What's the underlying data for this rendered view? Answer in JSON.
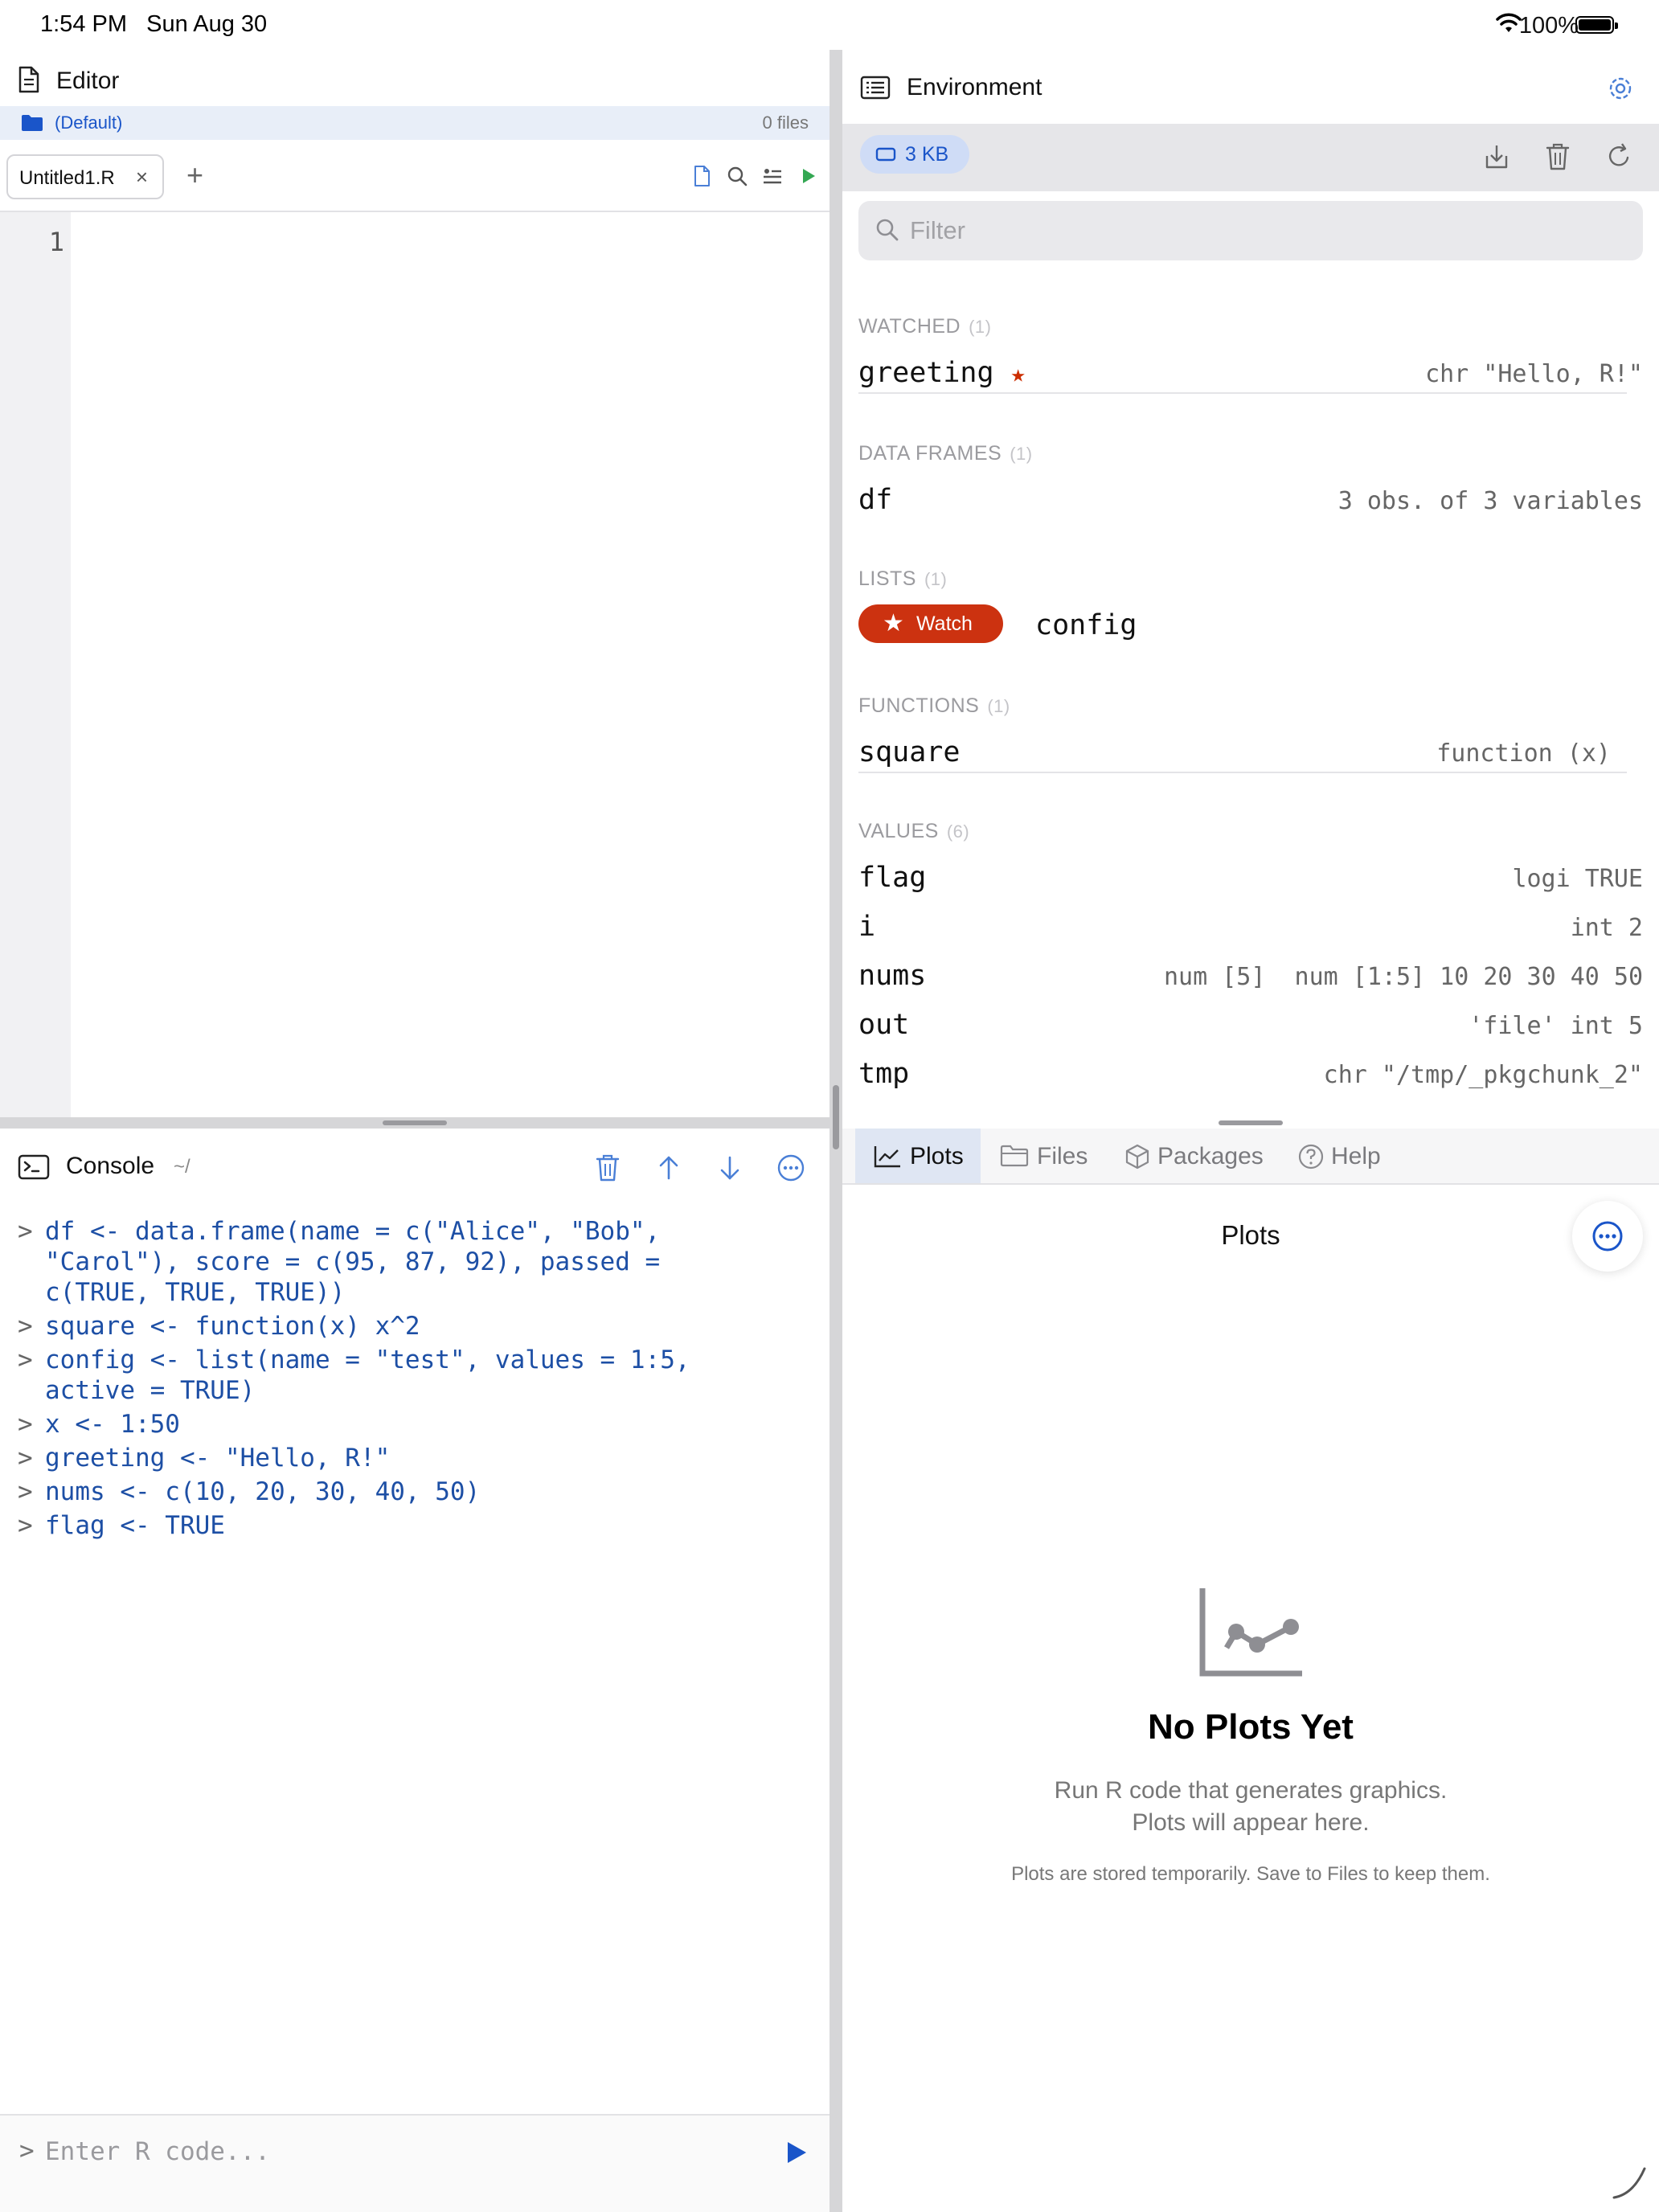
{
  "status_bar": {
    "time": "1:54 PM",
    "date": "Sun Aug 30",
    "battery": "100%"
  },
  "editor": {
    "title": "Editor",
    "project": {
      "name": "(Default)",
      "files": "0 files"
    },
    "tab": {
      "label": "Untitled1.R"
    },
    "line_numbers": [
      "1"
    ]
  },
  "console": {
    "title": "Console",
    "path": "~/",
    "lines": [
      {
        "prompt": ">",
        "text": "df <- data.frame(name = c(\"Alice\", \"Bob\","
      },
      {
        "prompt": "",
        "text": "\"Carol\"), score = c(95, 87, 92), passed ="
      },
      {
        "prompt": "",
        "text": "c(TRUE, TRUE, TRUE))"
      },
      {
        "prompt": ">",
        "text": "square <- function(x) x^2"
      },
      {
        "prompt": ">",
        "text": "config <- list(name = \"test\", values = 1:5,"
      },
      {
        "prompt": "",
        "text": "active = TRUE)"
      },
      {
        "prompt": ">",
        "text": "x <- 1:50"
      },
      {
        "prompt": ">",
        "text": "greeting <- \"Hello, R!\""
      },
      {
        "prompt": ">",
        "text": "nums <- c(10, 20, 30, 40, 50)"
      },
      {
        "prompt": ">",
        "text": "flag <- TRUE"
      }
    ],
    "input_prompt": ">",
    "input_placeholder": "Enter R code..."
  },
  "environment": {
    "title": "Environment",
    "memory": "3  KB",
    "filter_placeholder": "Filter",
    "sections": {
      "watched": {
        "label": "WATCHED",
        "count": "(1)"
      },
      "data_frames": {
        "label": "DATA FRAMES",
        "count": "(1)"
      },
      "lists": {
        "label": "LISTS",
        "count": "(1)"
      },
      "functions": {
        "label": "FUNCTIONS",
        "count": "(1)"
      },
      "values": {
        "label": "VALUES",
        "count": "(6)"
      }
    },
    "watched": [
      {
        "name": "greeting",
        "value": "chr \"Hello, R!\""
      }
    ],
    "data_frames": [
      {
        "name": "df",
        "value": "3 obs. of 3 variables"
      }
    ],
    "lists": [
      {
        "name": "config",
        "watch_label": "Watch"
      }
    ],
    "functions": [
      {
        "name": "square",
        "value": "function (x)"
      }
    ],
    "values": [
      {
        "name": "flag",
        "value": "logi TRUE"
      },
      {
        "name": "i",
        "value": "int 2"
      },
      {
        "name": "nums",
        "value": "num [5]  num [1:5] 10 20 30 40 50"
      },
      {
        "name": "out",
        "value": "'file' int 5"
      },
      {
        "name": "tmp",
        "value": "chr \"/tmp/_pkgchunk_2\""
      }
    ]
  },
  "bottom_tabs": [
    "Plots",
    "Files",
    "Packages",
    "Help"
  ],
  "plots": {
    "title": "Plots",
    "empty_title": "No Plots Yet",
    "empty_line1": "Run R code that generates graphics.",
    "empty_line2": "Plots will appear here.",
    "empty_note": "Plots are stored temporarily. Save to Files to keep them."
  },
  "colors": {
    "accent": "#1a55c9",
    "watch": "#cc3210",
    "run": "#34a853"
  }
}
